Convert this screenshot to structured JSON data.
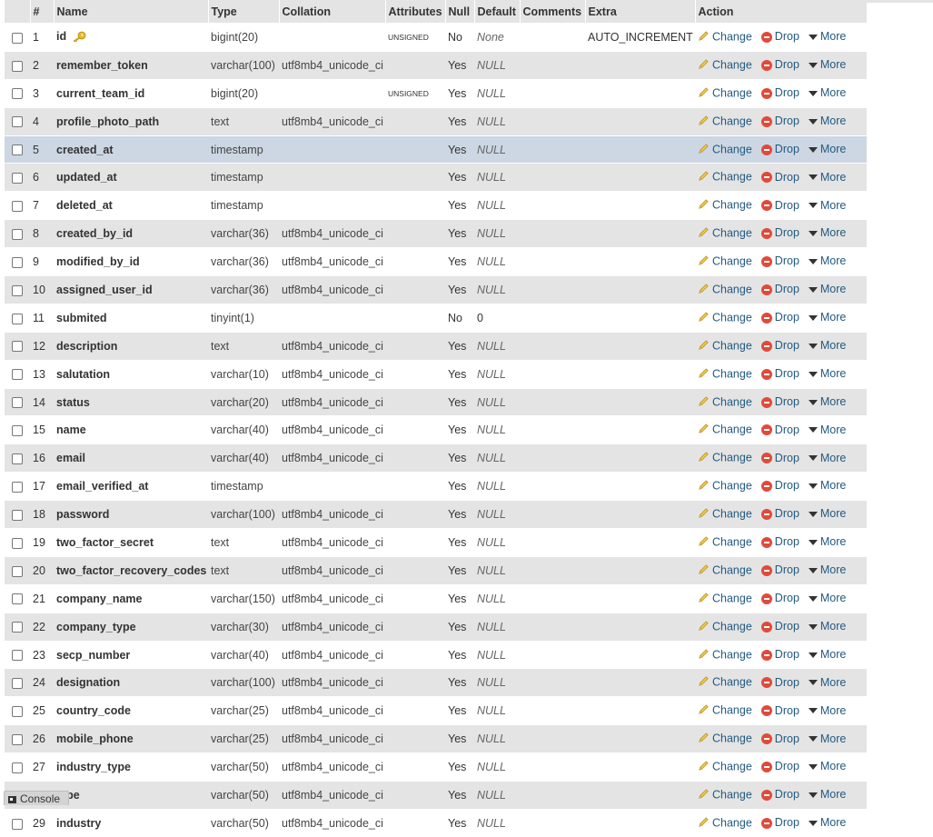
{
  "headers": {
    "num": "#",
    "name": "Name",
    "type": "Type",
    "collation": "Collation",
    "attributes": "Attributes",
    "null": "Null",
    "default": "Default",
    "comments": "Comments",
    "extra": "Extra",
    "action": "Action"
  },
  "actions": {
    "change": "Change",
    "drop": "Drop",
    "more": "More"
  },
  "console": {
    "label": "Console"
  },
  "rows": [
    {
      "num": "1",
      "name": "id",
      "type": "bigint(20)",
      "collation": "",
      "attributes": "UNSIGNED",
      "null": "No",
      "default": "None",
      "extra": "AUTO_INCREMENT"
    },
    {
      "num": "2",
      "name": "remember_token",
      "type": "varchar(100)",
      "collation": "utf8mb4_unicode_ci",
      "attributes": "",
      "null": "Yes",
      "default": "NULL",
      "extra": ""
    },
    {
      "num": "3",
      "name": "current_team_id",
      "type": "bigint(20)",
      "collation": "",
      "attributes": "UNSIGNED",
      "null": "Yes",
      "default": "NULL",
      "extra": ""
    },
    {
      "num": "4",
      "name": "profile_photo_path",
      "type": "text",
      "collation": "utf8mb4_unicode_ci",
      "attributes": "",
      "null": "Yes",
      "default": "NULL",
      "extra": ""
    },
    {
      "num": "5",
      "name": "created_at",
      "type": "timestamp",
      "collation": "",
      "attributes": "",
      "null": "Yes",
      "default": "NULL",
      "extra": ""
    },
    {
      "num": "6",
      "name": "updated_at",
      "type": "timestamp",
      "collation": "",
      "attributes": "",
      "null": "Yes",
      "default": "NULL",
      "extra": ""
    },
    {
      "num": "7",
      "name": "deleted_at",
      "type": "timestamp",
      "collation": "",
      "attributes": "",
      "null": "Yes",
      "default": "NULL",
      "extra": ""
    },
    {
      "num": "8",
      "name": "created_by_id",
      "type": "varchar(36)",
      "collation": "utf8mb4_unicode_ci",
      "attributes": "",
      "null": "Yes",
      "default": "NULL",
      "extra": ""
    },
    {
      "num": "9",
      "name": "modified_by_id",
      "type": "varchar(36)",
      "collation": "utf8mb4_unicode_ci",
      "attributes": "",
      "null": "Yes",
      "default": "NULL",
      "extra": ""
    },
    {
      "num": "10",
      "name": "assigned_user_id",
      "type": "varchar(36)",
      "collation": "utf8mb4_unicode_ci",
      "attributes": "",
      "null": "Yes",
      "default": "NULL",
      "extra": ""
    },
    {
      "num": "11",
      "name": "submited",
      "type": "tinyint(1)",
      "collation": "",
      "attributes": "",
      "null": "No",
      "default": "0",
      "extra": ""
    },
    {
      "num": "12",
      "name": "description",
      "type": "text",
      "collation": "utf8mb4_unicode_ci",
      "attributes": "",
      "null": "Yes",
      "default": "NULL",
      "extra": ""
    },
    {
      "num": "13",
      "name": "salutation",
      "type": "varchar(10)",
      "collation": "utf8mb4_unicode_ci",
      "attributes": "",
      "null": "Yes",
      "default": "NULL",
      "extra": ""
    },
    {
      "num": "14",
      "name": "status",
      "type": "varchar(20)",
      "collation": "utf8mb4_unicode_ci",
      "attributes": "",
      "null": "Yes",
      "default": "NULL",
      "extra": ""
    },
    {
      "num": "15",
      "name": "name",
      "type": "varchar(40)",
      "collation": "utf8mb4_unicode_ci",
      "attributes": "",
      "null": "Yes",
      "default": "NULL",
      "extra": ""
    },
    {
      "num": "16",
      "name": "email",
      "type": "varchar(40)",
      "collation": "utf8mb4_unicode_ci",
      "attributes": "",
      "null": "Yes",
      "default": "NULL",
      "extra": ""
    },
    {
      "num": "17",
      "name": "email_verified_at",
      "type": "timestamp",
      "collation": "",
      "attributes": "",
      "null": "Yes",
      "default": "NULL",
      "extra": ""
    },
    {
      "num": "18",
      "name": "password",
      "type": "varchar(100)",
      "collation": "utf8mb4_unicode_ci",
      "attributes": "",
      "null": "Yes",
      "default": "NULL",
      "extra": ""
    },
    {
      "num": "19",
      "name": "two_factor_secret",
      "type": "text",
      "collation": "utf8mb4_unicode_ci",
      "attributes": "",
      "null": "Yes",
      "default": "NULL",
      "extra": ""
    },
    {
      "num": "20",
      "name": "two_factor_recovery_codes",
      "type": "text",
      "collation": "utf8mb4_unicode_ci",
      "attributes": "",
      "null": "Yes",
      "default": "NULL",
      "extra": ""
    },
    {
      "num": "21",
      "name": "company_name",
      "type": "varchar(150)",
      "collation": "utf8mb4_unicode_ci",
      "attributes": "",
      "null": "Yes",
      "default": "NULL",
      "extra": ""
    },
    {
      "num": "22",
      "name": "company_type",
      "type": "varchar(30)",
      "collation": "utf8mb4_unicode_ci",
      "attributes": "",
      "null": "Yes",
      "default": "NULL",
      "extra": ""
    },
    {
      "num": "23",
      "name": "secp_number",
      "type": "varchar(40)",
      "collation": "utf8mb4_unicode_ci",
      "attributes": "",
      "null": "Yes",
      "default": "NULL",
      "extra": ""
    },
    {
      "num": "24",
      "name": "designation",
      "type": "varchar(100)",
      "collation": "utf8mb4_unicode_ci",
      "attributes": "",
      "null": "Yes",
      "default": "NULL",
      "extra": ""
    },
    {
      "num": "25",
      "name": "country_code",
      "type": "varchar(25)",
      "collation": "utf8mb4_unicode_ci",
      "attributes": "",
      "null": "Yes",
      "default": "NULL",
      "extra": ""
    },
    {
      "num": "26",
      "name": "mobile_phone",
      "type": "varchar(25)",
      "collation": "utf8mb4_unicode_ci",
      "attributes": "",
      "null": "Yes",
      "default": "NULL",
      "extra": ""
    },
    {
      "num": "27",
      "name": "industry_type",
      "type": "varchar(50)",
      "collation": "utf8mb4_unicode_ci",
      "attributes": "",
      "null": "Yes",
      "default": "NULL",
      "extra": ""
    },
    {
      "num": "28",
      "name": "type",
      "type": "varchar(50)",
      "collation": "utf8mb4_unicode_ci",
      "attributes": "",
      "null": "Yes",
      "default": "NULL",
      "extra": ""
    },
    {
      "num": "29",
      "name": "industry",
      "type": "varchar(50)",
      "collation": "utf8mb4_unicode_ci",
      "attributes": "",
      "null": "Yes",
      "default": "NULL",
      "extra": ""
    }
  ],
  "highlighted_row": "5",
  "primary_key_row": "1",
  "icons": {
    "change": "pencil-icon",
    "drop": "drop-icon",
    "more": "chevron-down-icon",
    "key": "key-icon",
    "console": "console-icon"
  },
  "colors": {
    "link": "#235a81",
    "row_alt": "#e4e4e4",
    "row_highlight": "#ccd7e3",
    "drop": "#e04a3a"
  }
}
